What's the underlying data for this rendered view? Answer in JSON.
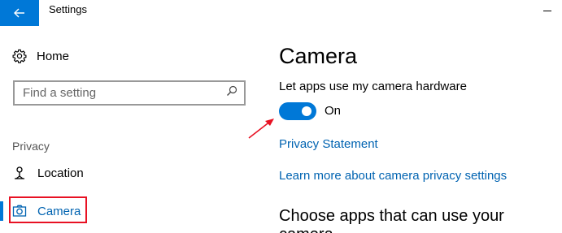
{
  "window": {
    "title": "Settings"
  },
  "sidebar": {
    "home_label": "Home",
    "search_placeholder": "Find a setting",
    "section_label": "Privacy",
    "items": [
      {
        "label": "Location",
        "icon": "location-icon"
      },
      {
        "label": "Camera",
        "icon": "camera-icon",
        "selected": true
      }
    ]
  },
  "main": {
    "title": "Camera",
    "setting_label": "Let apps use my camera hardware",
    "toggle": {
      "state": "On",
      "value": true
    },
    "links": {
      "privacy_statement": "Privacy Statement",
      "learn_more": "Learn more about camera privacy settings"
    },
    "subheading": "Choose apps that can use your camera"
  },
  "colors": {
    "accent": "#0078d7",
    "link": "#0063b1",
    "highlight": "#e81123"
  }
}
